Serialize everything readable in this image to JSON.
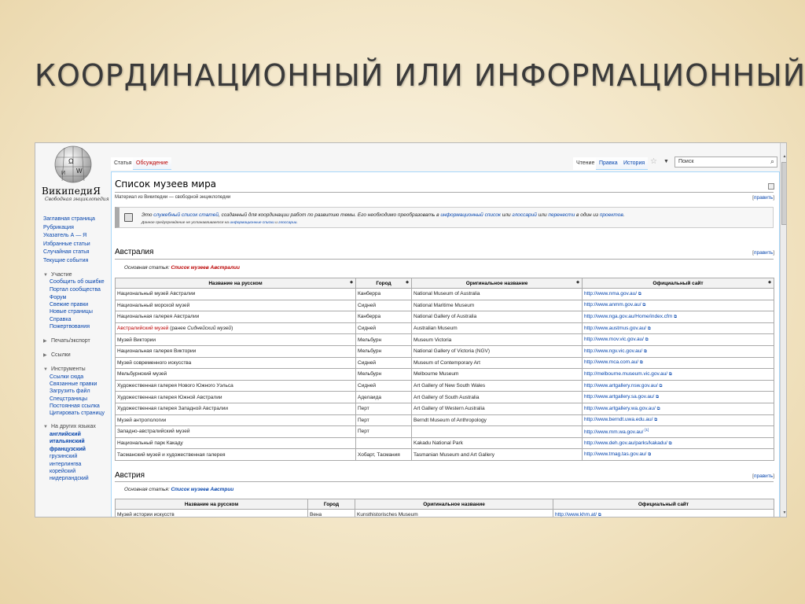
{
  "slide": {
    "title": "КООРДИНАЦИОННЫЙ ИЛИ ИНФОРМАЦИОННЫЙ?"
  },
  "logo": {
    "name": "ВикипедиЯ",
    "tagline": "Свободная энциклопедия"
  },
  "nav": {
    "main": [
      "Заглавная страница",
      "Рубрикация",
      "Указатель А — Я",
      "Избранные статьи",
      "Случайная статья",
      "Текущие события"
    ],
    "participation": {
      "heading": "Участие",
      "items": [
        "Сообщить об ошибке",
        "Портал сообщества",
        "Форум",
        "Свежие правки",
        "Новые страницы",
        "Справка",
        "Пожертвования"
      ]
    },
    "print": {
      "heading": "Печать/экспорт"
    },
    "links": {
      "heading": "Ссылки"
    },
    "tools": {
      "heading": "Инструменты",
      "items": [
        "Ссылки сюда",
        "Связанные правки",
        "Загрузить файл",
        "Спецстраницы",
        "Постоянная ссылка",
        "Цитировать страницу"
      ]
    },
    "languages": {
      "heading": "На других языках",
      "items": [
        "английский",
        "итальянский",
        "французский",
        "грузинский",
        "интерлингва",
        "корейский",
        "нидерландский"
      ]
    }
  },
  "tabs": {
    "article": "Статья",
    "talk": "Обсуждение",
    "read": "Чтение",
    "edit": "Правка",
    "history": "История"
  },
  "search": {
    "value": "Поиск"
  },
  "article": {
    "title": "Список музеев мира",
    "tagline": "Материал из Википедии — свободной энциклопедии",
    "edit_link": "править",
    "notice": {
      "p1": "Это ",
      "l1": "служебный список статей",
      "p2": ", созданный для координации работ по развитию темы. Его необходимо преобразовать в ",
      "l2": "информационный список",
      "p3": " или ",
      "l3": "глоссарий",
      "p4": " или ",
      "l4": "перенести",
      "p5": " в один из ",
      "l5": "проектов",
      "p6": ".",
      "sub_p1": "Данное предупреждение не устанавливается на ",
      "sub_l1": "информационные списки",
      "sub_p2": " и ",
      "sub_l2": "глоссарии",
      "sub_p3": "."
    }
  },
  "sections": [
    {
      "heading": "Австралия",
      "main_prefix": "Основная статья: ",
      "main_link": "Список музеев Австралии",
      "columns": [
        "Название на русском",
        "Город",
        "Оригинальное название",
        "Официальный сайт"
      ],
      "rows": [
        {
          "ru": "Национальный музей Австралии",
          "city": "Канберра",
          "orig": "National Museum of Australia",
          "site": "http://www.nma.gov.au/"
        },
        {
          "ru": "Национальный морской музей",
          "city": "Сидней",
          "orig": "National Maritime Museum",
          "site": "http://www.anmm.gov.au/"
        },
        {
          "ru": "Национальная галерея Австралии",
          "city": "Канберра",
          "orig": "National Gallery of Australia",
          "site": "http://www.nga.gov.au/Home/index.cfm"
        },
        {
          "ru": "Австралийский музей",
          "ru_extra": " (ранее ",
          "ru_extra_it": "Сиднейский музей",
          "ru_extra_end": ")",
          "city": "Сидней",
          "orig": "Australian Museum",
          "site": "http://www.austmus.gov.au/"
        },
        {
          "ru": "Музей Виктории",
          "city": "Мельбурн",
          "orig": "Museum Victoria",
          "site": "http://www.mov.vic.gov.au/"
        },
        {
          "ru": "Национальная галерея Виктории",
          "city": "Мельбурн",
          "orig": "National Gallery of Victoria (NGV)",
          "site": "http://www.ngv.vic.gov.au/"
        },
        {
          "ru": "Музей современного искусства",
          "city": "Сидней",
          "orig": "Museum of Contemporary Art",
          "site": "http://www.mca.com.au/"
        },
        {
          "ru": "Мельбурнский музей",
          "city": "Мельбурн",
          "orig": "Melbourne Museum",
          "site": "http://melbourne.museum.vic.gov.au/"
        },
        {
          "ru": "Художественная галерея Нового Южного Уэльса",
          "city": "Сидней",
          "orig": "Art Gallery of New South Wales",
          "site": "http://www.artgallery.nsw.gov.au/"
        },
        {
          "ru": "Художественная галерея Южной Австралии",
          "city": "Аделаида",
          "orig": "Art Gallery of South Australia",
          "site": "http://www.artgallery.sa.gov.au/"
        },
        {
          "ru": "Художественная галерея Западной Австралии",
          "city": "Перт",
          "orig": "Art Gallery of Western Australia",
          "site": "http://www.artgallery.wa.gov.au/"
        },
        {
          "ru": "Музей антропологии",
          "city": "Перт",
          "orig": "Berndt Museum of Anthropology",
          "site": "http://www.berndt.uwa.edu.au/"
        },
        {
          "ru": "Западно-австралийский музей",
          "city": "Перт",
          "orig": "",
          "site": "http://www.mm.wa.gov.au/",
          "sup": "[1]"
        },
        {
          "ru": "Национальный парк Какаду",
          "city": "",
          "orig": "Kakadu National Park",
          "site": "http://www.deh.gov.au/parks/kakadu/"
        },
        {
          "ru": "Тасманский музей и художественная галерея",
          "city": "Хобарт, Тасмания",
          "orig": "Tasmanian Museum and Art Gallery",
          "site": "http://www.tmag.tas.gov.au/"
        }
      ]
    },
    {
      "heading": "Австрия",
      "main_prefix": "Основная статья: ",
      "main_link": "Список музеев Австрии",
      "columns": [
        "Название на русском",
        "Город",
        "Оригинальное название",
        "Официальный сайт"
      ],
      "rows": [
        {
          "ru": "Музей истории искусств",
          "city": "Вена",
          "orig": "Kunsthistorisches Museum",
          "site": "http://www.khm.at/"
        }
      ]
    }
  ]
}
